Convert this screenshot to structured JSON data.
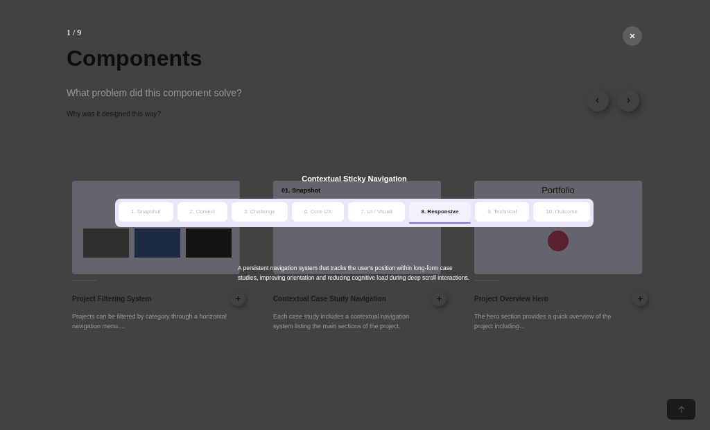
{
  "page": {
    "counter": "1 / 9",
    "title": "Components",
    "question": "What problem did this component solve?",
    "subquestion": "Why was it designed this way?"
  },
  "cards": [
    {
      "kind": "gallery",
      "title": "Project Filtering System",
      "description": "Projects can be filtered by category through a horizontal navigation menu...."
    },
    {
      "kind": "sections",
      "thumb_text": "01. Snapshot",
      "title": "Contextual Case Study Navigation",
      "description": "Each case study includes a contextual navigation system listing the main sections of the project."
    },
    {
      "kind": "hero",
      "thumb_text": "Portfolio",
      "title": "Project Overview Hero",
      "description": "The hero section provides a quick overview of the project including..."
    }
  ],
  "modal": {
    "title": "Contextual Sticky Navigation",
    "tabs": [
      {
        "label": "1. Snapshot",
        "selected": false
      },
      {
        "label": "2. Context",
        "selected": false
      },
      {
        "label": "3. Challenge",
        "selected": false
      },
      {
        "label": "6. Core UX",
        "selected": false
      },
      {
        "label": "7. UI  / Visual",
        "selected": false
      },
      {
        "label": "8. Responsive",
        "selected": true
      },
      {
        "label": "9. Technical",
        "selected": false
      },
      {
        "label": "10. Outcome",
        "selected": false
      }
    ],
    "description": "A persistent navigation system that tracks the user's position within long-form case studies, improving orientation and reducing cognitive load during deep scroll interactions."
  }
}
